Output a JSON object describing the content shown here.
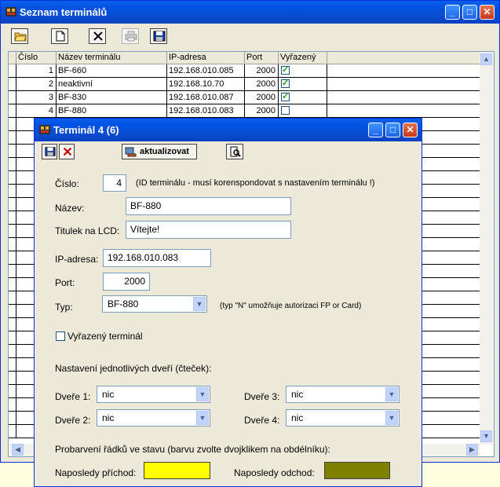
{
  "main_window": {
    "title": "Seznam terminálů",
    "columns": [
      "Číslo",
      "Název terminálu",
      "IP-adresa",
      "Port",
      "Vyřazený"
    ],
    "rows": [
      {
        "id": "1",
        "name": "BF-660",
        "ip": "192.168.010.085",
        "port": "2000",
        "disabled": true
      },
      {
        "id": "2",
        "name": "neaktivní",
        "ip": "192.168.10.70",
        "port": "2000",
        "disabled": true
      },
      {
        "id": "3",
        "name": "BF-830",
        "ip": "192.168.010.087",
        "port": "2000",
        "disabled": true
      },
      {
        "id": "4",
        "name": "BF-880",
        "ip": "192.168.010.083",
        "port": "2000",
        "disabled": false
      }
    ],
    "toolbar_icons": [
      "open-folder-icon",
      "new-document-icon",
      "delete-icon",
      "print-icon",
      "save-icon"
    ]
  },
  "dialog": {
    "title": "Terminál 4 (6)",
    "update_label": "aktualizovat",
    "cislo_label": "Číslo:",
    "cislo_value": "4",
    "cislo_hint": "(ID terminálu - musí korenspondovat s nastavením terminálu !)",
    "nazev_label": "Název:",
    "nazev_value": "BF-880",
    "lcd_label": "Titulek na LCD:",
    "lcd_value": "Vítejte!",
    "ip_label": "IP-adresa:",
    "ip_value": "192.168.010.083",
    "port_label": "Port:",
    "port_value": "2000",
    "typ_label": "Typ:",
    "typ_value": "BF-880",
    "typ_hint": "(typ \"N\" umožňuje autorizaci FP or Card)",
    "disabled_label": "Vyřazený terminál",
    "doors_heading": "Nastavení jednotlivých dveří (čteček):",
    "door1_label": "Dveře 1:",
    "door1_value": "nic",
    "door2_label": "Dveře 2:",
    "door2_value": "nic",
    "door3_label": "Dveře 3:",
    "door3_value": "nic",
    "door4_label": "Dveře 4:",
    "door4_value": "nic",
    "coloring_heading": "Probarvení řádků ve stavu (barvu zvolte dvojklikem na obdélníku):",
    "last_in_label": "Naposledy příchod:",
    "last_out_label": "Naposledy odchod:",
    "last_in_color": "#ffff00",
    "last_out_color": "#808000"
  }
}
